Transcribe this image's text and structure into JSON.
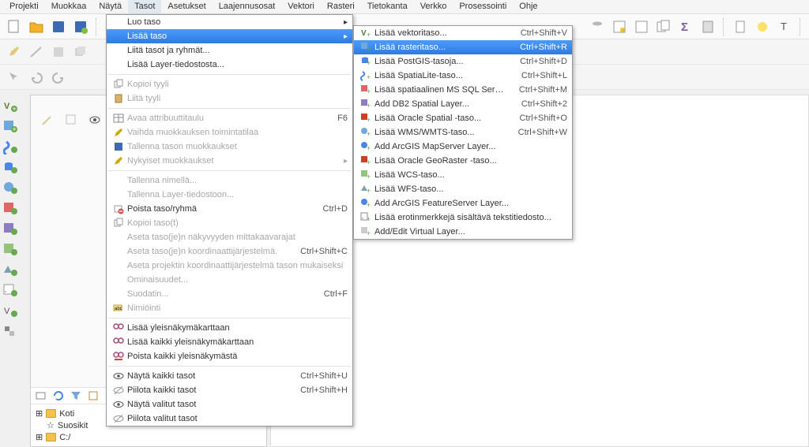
{
  "menubar": [
    "Projekti",
    "Muokkaa",
    "Näytä",
    "Tasot",
    "Asetukset",
    "Laajennusosat",
    "Vektori",
    "Rasteri",
    "Tietokanta",
    "Verkko",
    "Prosessointi",
    "Ohje"
  ],
  "menu1": {
    "items": [
      {
        "label": "Luo taso",
        "arrow": true
      },
      {
        "label": "Lisää taso",
        "arrow": true,
        "hovered": true
      },
      {
        "label": "Liitä tasot ja ryhmät..."
      },
      {
        "label": "Lisää Layer-tiedostosta..."
      },
      {
        "sep": true
      },
      {
        "label": "Kopioi tyyli",
        "disabled": true,
        "icon": "copy"
      },
      {
        "label": "Liitä tyyli",
        "disabled": true,
        "icon": "paste"
      },
      {
        "sep": true
      },
      {
        "label": "Avaa attribuuttitaulu",
        "disabled": true,
        "shortcut": "F6",
        "icon": "table"
      },
      {
        "label": "Vaihda muokkauksen toimintatilaa",
        "disabled": true,
        "icon": "pencil"
      },
      {
        "label": "Tallenna tason muokkaukset",
        "disabled": true,
        "icon": "save"
      },
      {
        "label": "Nykyiset muokkaukset",
        "disabled": true,
        "arrow": true,
        "icon": "pencil"
      },
      {
        "sep": true
      },
      {
        "label": "Tallenna nimellä...",
        "disabled": true
      },
      {
        "label": "Tallenna Layer-tiedostoon...",
        "disabled": true
      },
      {
        "label": "Poista taso/ryhmä",
        "shortcut": "Ctrl+D",
        "icon": "remove"
      },
      {
        "label": "Kopioi taso(t)",
        "disabled": true,
        "icon": "copy"
      },
      {
        "label": "Aseta taso(je)n näkyvyyden mittakaavarajat",
        "disabled": true
      },
      {
        "label": "Aseta taso(je)n koordinaattijärjestelmä.",
        "disabled": true,
        "shortcut": "Ctrl+Shift+C"
      },
      {
        "label": "Aseta projektin koordinaattijärjestelmä tason mukaiseksi",
        "disabled": true
      },
      {
        "label": "Ominaisuudet...",
        "disabled": true
      },
      {
        "label": "Suodatin...",
        "disabled": true,
        "shortcut": "Ctrl+F"
      },
      {
        "label": "Nimiöinti",
        "disabled": true,
        "icon": "label"
      },
      {
        "sep": true
      },
      {
        "label": "Lisää yleisnäkymäkarttaan",
        "icon": "overview"
      },
      {
        "label": "Lisää kaikki yleisnäkymäkarttaan",
        "icon": "overview"
      },
      {
        "label": "Poista kaikki yleisnäkymästä",
        "icon": "overview-remove"
      },
      {
        "sep": true
      },
      {
        "label": "Näytä kaikki tasot",
        "shortcut": "Ctrl+Shift+U",
        "icon": "eye"
      },
      {
        "label": "Piilota kaikki tasot",
        "shortcut": "Ctrl+Shift+H",
        "icon": "eye-off"
      },
      {
        "label": "Näytä valitut tasot",
        "icon": "eye"
      },
      {
        "label": "Piilota valitut tasot",
        "icon": "eye-off"
      }
    ]
  },
  "menu2": {
    "items": [
      {
        "label": "Lisää vektoritaso...",
        "shortcut": "Ctrl+Shift+V",
        "icon": "v"
      },
      {
        "label": "Lisää rasteritaso...",
        "shortcut": "Ctrl+Shift+R",
        "hovered": true,
        "icon": "r"
      },
      {
        "label": "Lisää PostGIS-tasoja...",
        "shortcut": "Ctrl+Shift+D",
        "icon": "db"
      },
      {
        "label": "Lisää SpatiaLite-taso...",
        "shortcut": "Ctrl+Shift+L",
        "icon": "sl"
      },
      {
        "label": "Lisää spatiaalinen MS SQL Server -taso...",
        "shortcut": "Ctrl+Shift+M",
        "icon": "ms"
      },
      {
        "label": "Add DB2 Spatial Layer...",
        "shortcut": "Ctrl+Shift+2",
        "icon": "db2"
      },
      {
        "label": "Lisää Oracle Spatial -taso...",
        "shortcut": "Ctrl+Shift+O",
        "icon": "or"
      },
      {
        "label": "Lisää WMS/WMTS-taso...",
        "shortcut": "Ctrl+Shift+W",
        "icon": "wms"
      },
      {
        "label": "Add ArcGIS MapServer Layer...",
        "icon": "ags"
      },
      {
        "label": "Lisää Oracle GeoRaster -taso...",
        "icon": "or"
      },
      {
        "label": "Lisää WCS-taso...",
        "icon": "wcs"
      },
      {
        "label": "Lisää WFS-taso...",
        "icon": "wfs"
      },
      {
        "label": "Add ArcGIS FeatureServer Layer...",
        "icon": "ags"
      },
      {
        "label": "Lisää erotinmerkkejä sisältävä tekstitiedosto...",
        "icon": "csv"
      },
      {
        "label": "Add/Edit Virtual Layer...",
        "icon": "vl"
      }
    ]
  },
  "tree": {
    "koti": "Koti",
    "suosikit": "Suosikit",
    "c": "C:/"
  }
}
